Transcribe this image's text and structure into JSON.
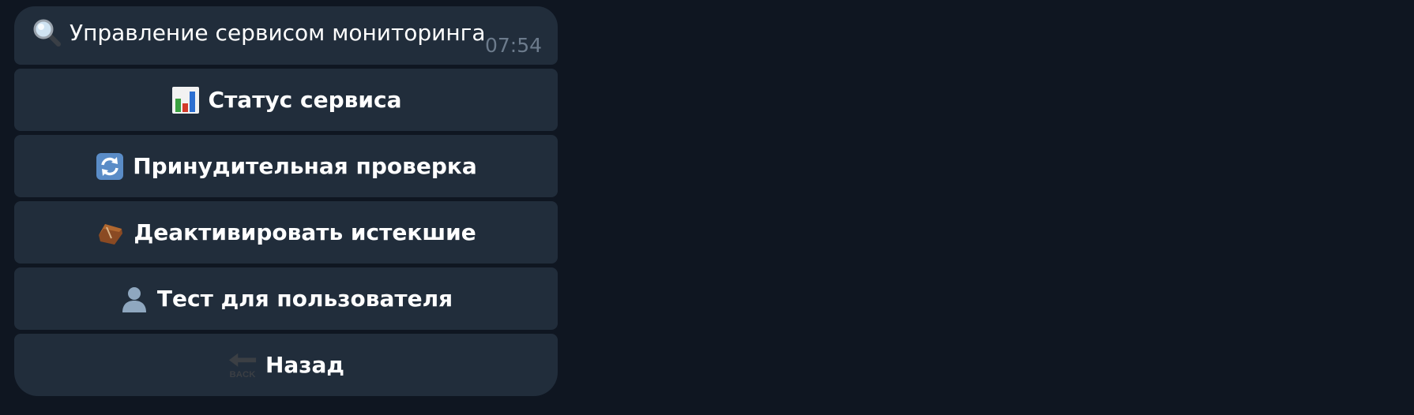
{
  "message": {
    "text": "Управление сервисом мониторинга",
    "time": "07:54",
    "icon": "magnifier-icon"
  },
  "keyboard": {
    "buttons": [
      {
        "label": "Статус сервиса",
        "icon": "bar-chart-icon"
      },
      {
        "label": "Принудительная проверка",
        "icon": "refresh-icon"
      },
      {
        "label": "Деактивировать истекшие",
        "icon": "coffin-icon"
      },
      {
        "label": "Тест для пользователя",
        "icon": "user-silhouette-icon"
      },
      {
        "label": "Назад",
        "icon": "back-arrow-icon",
        "icon_text": "BACK"
      }
    ]
  },
  "colors": {
    "background": "#0f1621",
    "bubble": "#212d3b",
    "text": "#ffffff",
    "time": "#6c7b8c"
  }
}
